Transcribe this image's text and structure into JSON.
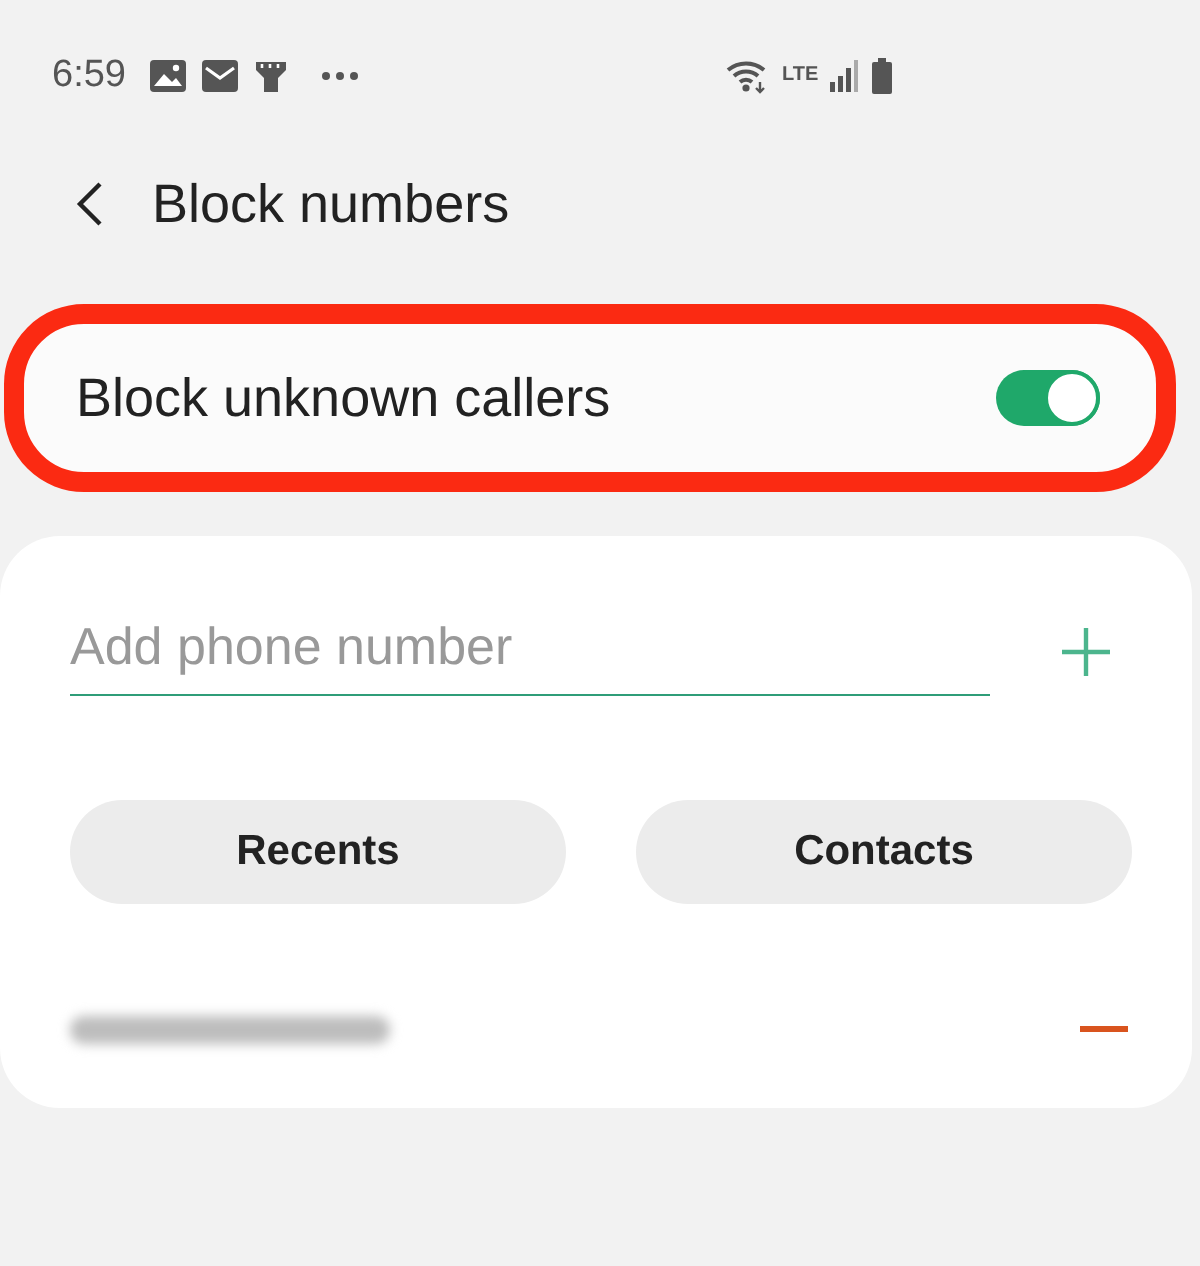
{
  "status_bar": {
    "time": "6:59",
    "network": "LTE"
  },
  "header": {
    "title": "Block numbers"
  },
  "block_unknown": {
    "label": "Block unknown callers",
    "on": true,
    "highlighted": true
  },
  "add_field": {
    "placeholder": "Add phone number"
  },
  "buttons": [
    {
      "label": "Recents"
    },
    {
      "label": "Contacts"
    }
  ],
  "blocked_numbers": [
    {
      "kind": "blurred"
    }
  ]
}
